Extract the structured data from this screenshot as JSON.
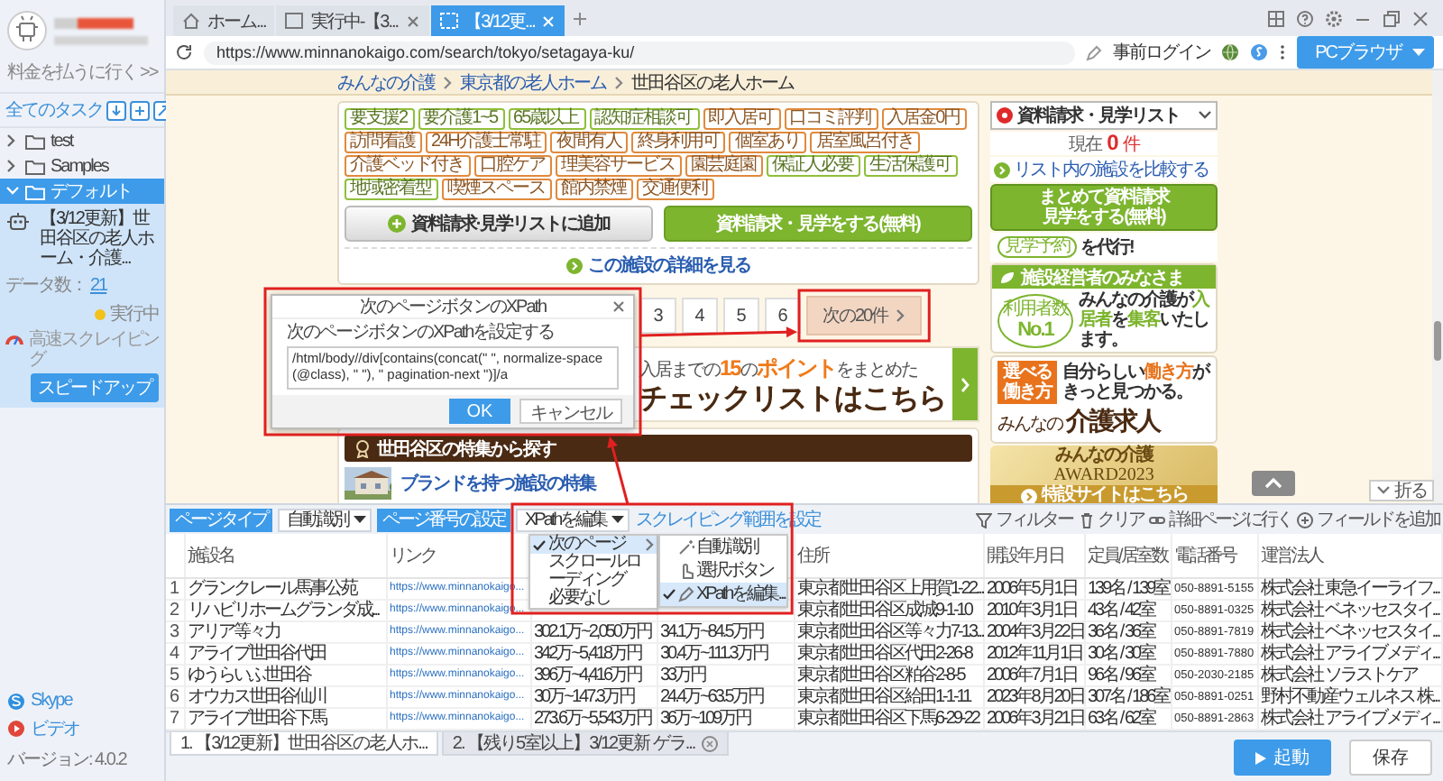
{
  "sidebar": {
    "pay_link": "料金を払うに行く >>",
    "section_title": "全てのタスク",
    "folders": [
      {
        "name": "test",
        "expanded": false,
        "selected": false
      },
      {
        "name": "Samples",
        "expanded": false,
        "selected": false
      },
      {
        "name": "デフォルト",
        "expanded": true,
        "selected": true,
        "tasks": [
          {
            "title": "【3/12更新】世田谷区の老人ホーム・介護...",
            "data_count_label": "データ数：",
            "data_count": "21",
            "status": "実行中",
            "mode": "高速スクレイピング",
            "action": "スピードアップ"
          }
        ]
      }
    ],
    "footer": {
      "skype": "Skype",
      "video": "ビデオ",
      "version": "バージョン: 4.0.2"
    }
  },
  "browser": {
    "tabs": [
      {
        "label": "ホーム...",
        "kind": "home",
        "selected": false,
        "closable": false
      },
      {
        "label": "実行中-【3...",
        "kind": "page",
        "selected": false,
        "closable": true
      },
      {
        "label": "【3/12更...",
        "kind": "page",
        "selected": true,
        "closable": true
      }
    ],
    "url": "https://www.minnanokaigo.com/search/tokyo/setagaya-ku/",
    "login": "事前ログイン",
    "mode_button": "PCブラウザ"
  },
  "webpage": {
    "breadcrumb": [
      "みんなの介護",
      "東京都の老人ホーム",
      "世田谷区の老人ホーム"
    ],
    "tags": [
      {
        "label": "要支援2",
        "color": "#8fbf3a"
      },
      {
        "label": "要介護1~5",
        "color": "#8fbf3a"
      },
      {
        "label": "65歳以上",
        "color": "#8fbf3a"
      },
      {
        "label": "認知症相談可",
        "color": "#8fbf3a"
      },
      {
        "label": "即入居可",
        "color": "#e08a3c"
      },
      {
        "label": "口コミ評判",
        "color": "#e08a3c"
      },
      {
        "label": "入居金0円",
        "color": "#e08a3c"
      },
      {
        "label": "訪問看護",
        "color": "#e08a3c"
      },
      {
        "label": "24H介護士常駐",
        "color": "#e08a3c"
      },
      {
        "label": "夜間有人",
        "color": "#e08a3c"
      },
      {
        "label": "終身利用可",
        "color": "#e08a3c"
      },
      {
        "label": "個室あり",
        "color": "#e08a3c"
      },
      {
        "label": "居室風呂付き",
        "color": "#e08a3c"
      },
      {
        "label": "介護ベッド付き",
        "color": "#e08a3c"
      },
      {
        "label": "口腔ケア",
        "color": "#e08a3c"
      },
      {
        "label": "理美容サービス",
        "color": "#e08a3c"
      },
      {
        "label": "園芸庭園",
        "color": "#e08a3c"
      },
      {
        "label": "保証人必要",
        "color": "#8fbf3a"
      },
      {
        "label": "生活保護可",
        "color": "#8fbf3a"
      },
      {
        "label": "地域密着型",
        "color": "#8fbf3a"
      },
      {
        "label": "喫煙スペース",
        "color": "#e08a3c"
      },
      {
        "label": "館内禁煙",
        "color": "#e08a3c"
      },
      {
        "label": "交通便利",
        "color": "#e08a3c"
      }
    ],
    "add_list_button": "資料請求·見学リストに追加",
    "request_button": "資料請求・見学をする(無料)",
    "detail_link": "この施設の詳細を見る",
    "pages": [
      "3",
      "4",
      "5",
      "6"
    ],
    "next_button": "次の20件",
    "banner": {
      "line1": "入居までの**15**の**ポイント**をまとめた",
      "line2": "チェックリストはこちら"
    },
    "feature_title": "世田谷区の特集から探す",
    "feature_item": "ブランドを持つ施設の特集",
    "side": {
      "list_dropdown": "資料請求・見学リスト",
      "count_label": "現在",
      "count": "0",
      "count_unit": "件",
      "compare_link": "リスト内の施設を比較する",
      "bulk_line1": "まとめて資料請求",
      "bulk_line2": "見学をする(無料)",
      "visit_tag": "見学予約",
      "visit_text": "を代行!",
      "owner_title": "施設経営者のみなさま",
      "owner_badge_top": "利用者数",
      "owner_badge": "No.1",
      "owner_text": "みんなの介護が**入居者**を**集客**いたします。",
      "jobs_badge": "選べる働き方",
      "jobs_text": "自分らしい**働き方**がきっと見つかる。",
      "jobs_logo_small": "みんなの",
      "jobs_logo": "介護求人",
      "award_title": "みんなの介護",
      "award_year": "AWARD2023",
      "award_link": "特設サイトはこちら"
    },
    "fold_button": "折る"
  },
  "dialog": {
    "title": "次のページボタンのXPath",
    "label": "次のページボタンのXPathを設定する",
    "value": "/html/body//div[contains(concat(\" \", normalize-space(@class), \" \"), \" pagination-next \")]/a",
    "ok": "OK",
    "cancel": "キャンセル"
  },
  "toolbar": {
    "page_type_label": "ページタイプ",
    "page_type_value": "自動識別",
    "page_number_label": "ページ番号の設定",
    "page_number_value": "XPathを編集",
    "scope_link": "スクレイピング範囲を設定",
    "actions": [
      {
        "label": "フィルター",
        "kind": "filter"
      },
      {
        "label": "クリア",
        "kind": "clear"
      },
      {
        "label": "詳細ページに行く",
        "kind": "link"
      },
      {
        "label": "フィールドを追加",
        "kind": "add"
      }
    ]
  },
  "menu": {
    "items": [
      {
        "label": "次のページ",
        "selected": true,
        "has_submenu": true
      },
      {
        "label": "スクロールローディング",
        "selected": false,
        "has_submenu": false
      },
      {
        "label": "必要なし",
        "selected": false,
        "has_submenu": false
      }
    ],
    "submenu": [
      {
        "label": "自動識別",
        "kind": "auto",
        "selected": false
      },
      {
        "label": "選択ボタン",
        "kind": "click",
        "selected": false
      },
      {
        "label": "XPathを編集...",
        "kind": "edit",
        "selected": true
      }
    ]
  },
  "table": {
    "columns": [
      {
        "label": "施設名",
        "kind": "text"
      },
      {
        "label": "リンク",
        "kind": "link"
      },
      {
        "kind": "text"
      },
      {
        "kind": "text"
      },
      {
        "label": "住所",
        "kind": "text"
      },
      {
        "label": "開設年月日",
        "kind": "text"
      },
      {
        "label": "定員/居室数",
        "kind": "text"
      },
      {
        "label": "電話番号",
        "kind": "phone"
      },
      {
        "label": "運営法人",
        "kind": "text"
      }
    ],
    "rows": [
      {
        "no": "1",
        "cells": [
          "グランクレール馬事公苑",
          "https://www.minnanokaigo...",
          null,
          null,
          "東京都世田谷区上用賀1-22...",
          "2006年5月1日",
          "139名 / 139室",
          "050-8891-5155",
          "株式会社 東急イーライフ..."
        ]
      },
      {
        "no": "2",
        "cells": [
          "リハビリホームグランダ成...",
          "https://www.minnanokaigo...",
          null,
          null,
          "東京都世田谷区成城9-1-10",
          "2010年3月1日",
          "43名 / 42室",
          "050-8891-0325",
          "株式会社 ベネッセスタイ..."
        ]
      },
      {
        "no": "3",
        "cells": [
          "アリア等々力",
          "https://www.minnanokaigo...",
          "302.1万~2,050万円",
          "34.1万~84.5万円",
          "東京都世田谷区等々力7-13...",
          "2004年3月22日",
          "36名 / 36室",
          "050-8891-7819",
          "株式会社 ベネッセスタイ..."
        ]
      },
      {
        "no": "4",
        "cells": [
          "アライブ世田谷代田",
          "https://www.minnanokaigo...",
          "342万~5,418万円",
          "30.4万~111.3万円",
          "東京都世田谷区代田2-26-8",
          "2012年11月1日",
          "30名 / 30室",
          "050-8891-7880",
          "株式会社 アライブメディ..."
        ]
      },
      {
        "no": "5",
        "cells": [
          "ゆうらいふ世田谷",
          "https://www.minnanokaigo...",
          "396万~4,416万円",
          "33万円",
          "東京都世田谷区粕谷2-8-5",
          "2006年7月1日",
          "96名 / 96室",
          "050-2030-2185",
          "株式会社 ソラストケア"
        ]
      },
      {
        "no": "6",
        "cells": [
          "オウカス世田谷仙川",
          "https://www.minnanokaigo...",
          "30万~147.3万円",
          "24.4万~63.5万円",
          "東京都世田谷区給田1-1-11",
          "2023年8月20日",
          "307名 / 186室",
          "050-8891-0251",
          "野村不動産ウェルネス 株..."
        ]
      },
      {
        "no": "7",
        "cells": [
          "アライブ世田谷下馬",
          "https://www.minnanokaigo...",
          "273.6万~5,543万円",
          "36万~109万円",
          "東京都世田谷区下馬6-29-22",
          "2006年3月21日",
          "63名 / 62室",
          "050-8891-2863",
          "株式会社 アライブメディ..."
        ]
      }
    ]
  },
  "run_tabs": [
    {
      "label": "1. 【3/12更新】世田谷区の老人ホ...",
      "selected": true,
      "closable": false
    },
    {
      "label": "2. 【残り5室以上】3/12更新 ゲラ...",
      "selected": false,
      "closable": true
    }
  ],
  "buttons": {
    "run": "起動",
    "save": "保存"
  }
}
